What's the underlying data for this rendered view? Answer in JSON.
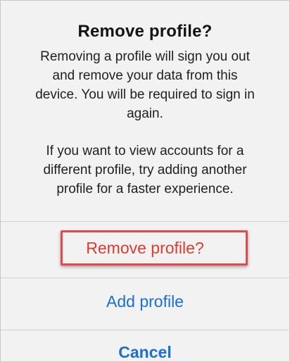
{
  "dialog": {
    "title": "Remove profile?",
    "message_lines": [
      "Removing a profile will sign you out",
      "and remove your data from this",
      "device. You will be required to sign in",
      "again."
    ],
    "secondary_lines": [
      "If you want to view accounts for a",
      "different profile, try adding another",
      "profile for a faster experience."
    ],
    "actions": {
      "remove_label": "Remove profile?",
      "add_label": "Add profile",
      "cancel_label": "Cancel"
    }
  },
  "colors": {
    "destructive": "#e03a2f",
    "link": "#1a6fd4",
    "highlight_border": "#e8474c",
    "background": "#f2f2f2"
  }
}
